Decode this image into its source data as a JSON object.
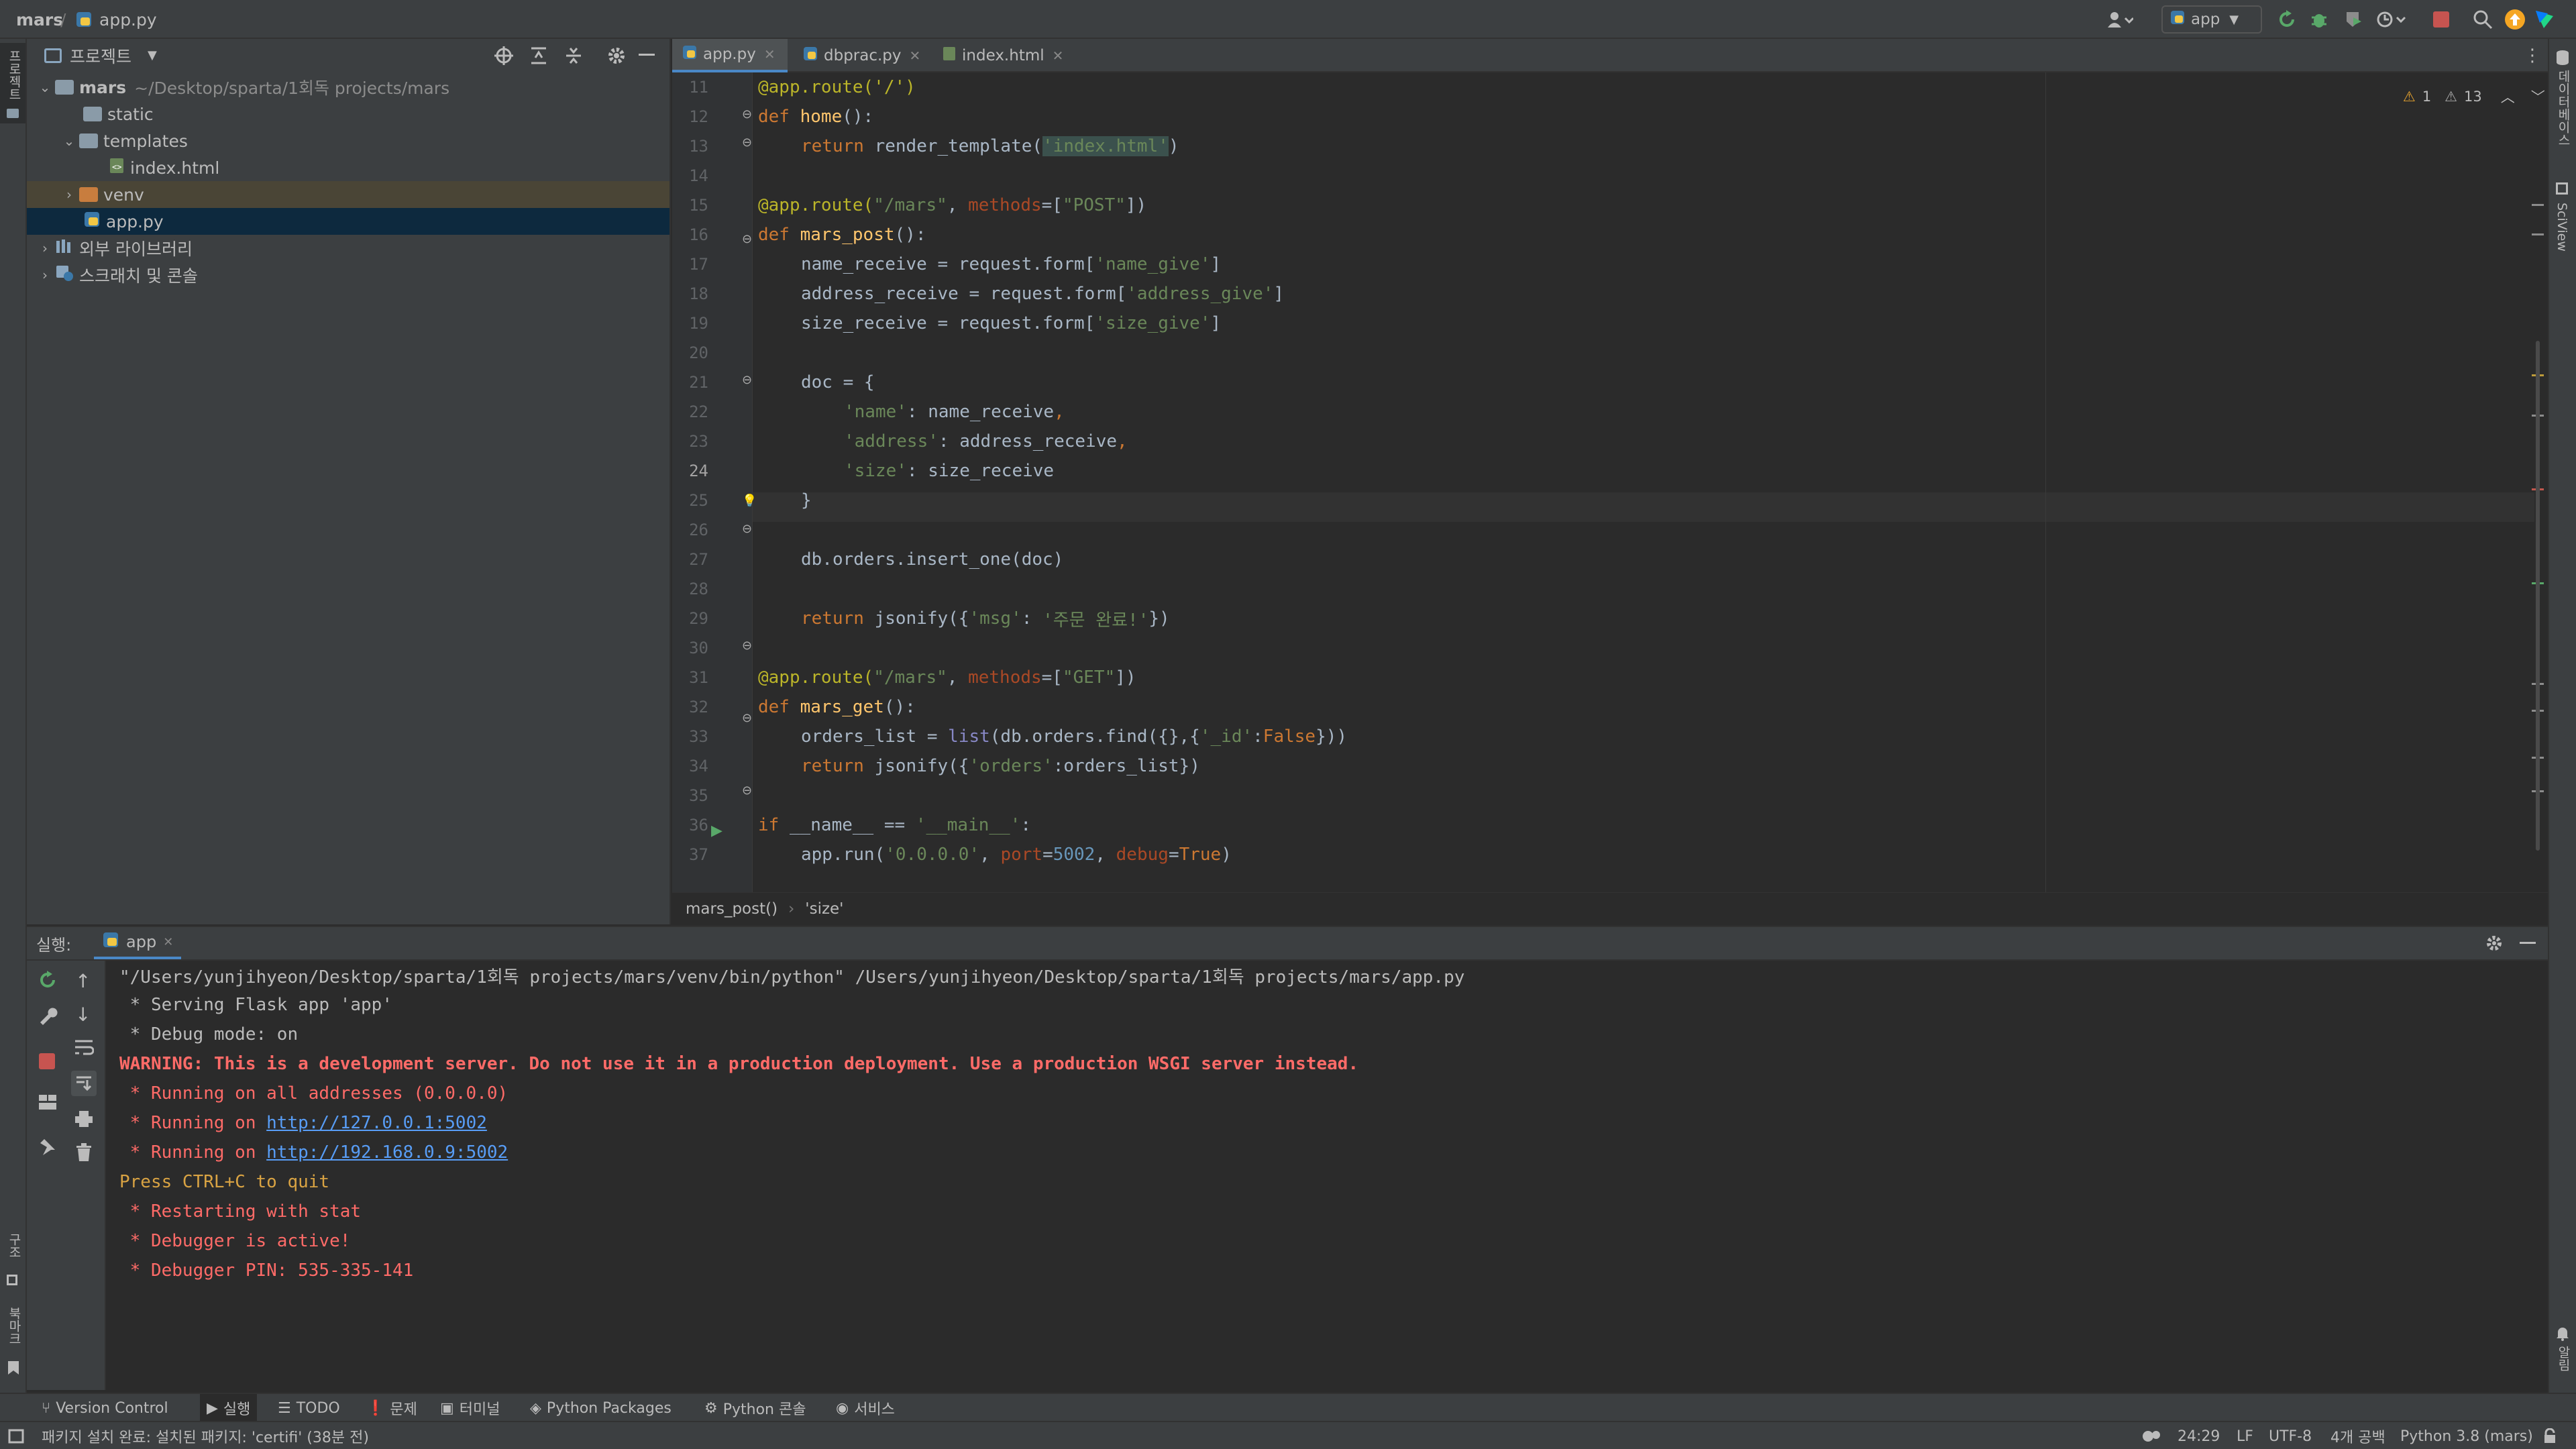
{
  "titlebar": {
    "project": "mars",
    "file": "app.py",
    "run_config": "app"
  },
  "left_strip": {
    "top_label": "프로젝트",
    "mid_label": "구조",
    "bottom_label": "북마크"
  },
  "right_strip": {
    "top_label": "데이터베이스",
    "mid_label": "SciView",
    "bottom_label": "알림"
  },
  "project_panel": {
    "title": "프로젝트",
    "tree": [
      {
        "label": "mars",
        "path": "~/Desktop/sparta/1회독 projects/mars",
        "expanded": true,
        "indent": 0
      },
      {
        "label": "static",
        "indent": 1
      },
      {
        "label": "templates",
        "expanded": true,
        "indent": 1
      },
      {
        "label": "index.html",
        "indent": 2
      },
      {
        "label": "venv",
        "indent": 1
      },
      {
        "label": "app.py",
        "indent": 1
      },
      {
        "label": "외부 라이브러리",
        "indent": 0
      },
      {
        "label": "스크래치 및 콘솔",
        "indent": 0
      }
    ]
  },
  "editor": {
    "tabs": [
      {
        "label": "app.py",
        "active": true
      },
      {
        "label": "dbprac.py",
        "active": false
      },
      {
        "label": "index.html",
        "active": false
      }
    ],
    "inspections": {
      "warnings": "1",
      "weak_warnings": "13"
    },
    "line_numbers": [
      "11",
      "12",
      "13",
      "14",
      "15",
      "16",
      "17",
      "18",
      "19",
      "20",
      "21",
      "22",
      "23",
      "24",
      "25",
      "26",
      "27",
      "28",
      "29",
      "30",
      "31",
      "32",
      "33",
      "34",
      "35",
      "36",
      "37"
    ],
    "breadcrumb": [
      "mars_post()",
      "'size'"
    ]
  },
  "run_panel": {
    "label": "실행:",
    "tab": "app",
    "output": [
      "\"/Users/yunjihyeon/Desktop/sparta/1회독 projects/mars/venv/bin/python\" /Users/yunjihyeon/Desktop/sparta/1회독 projects/mars/app.py",
      " * Serving Flask app 'app'",
      " * Debug mode: on",
      "WARNING: This is a development server. Do not use it in a production deployment. Use a production WSGI server instead.",
      " * Running on all addresses (0.0.0.0)",
      " * Running on ",
      "http://127.0.0.1:5002",
      " * Running on ",
      "http://192.168.0.9:5002",
      "Press CTRL+C to quit",
      " * Restarting with stat",
      " * Debugger is active!",
      " * Debugger PIN: 535-335-141"
    ]
  },
  "bottom_tabs": [
    {
      "label": "Version Control"
    },
    {
      "label": "실행"
    },
    {
      "label": "TODO"
    },
    {
      "label": "문제"
    },
    {
      "label": "터미널"
    },
    {
      "label": "Python Packages"
    },
    {
      "label": "Python 콘솔"
    },
    {
      "label": "서비스"
    }
  ],
  "status": {
    "message": "패키지 설치 완료: 설치된 패키지: 'certifi' (38분 전)",
    "position": "24:29",
    "line_sep": "LF",
    "encoding": "UTF-8",
    "indent": "4개 공백",
    "interpreter": "Python 3.8 (mars)"
  },
  "code": {
    "l11": "@app.route('/')",
    "l12_kw": "def ",
    "l12_fn": "home",
    "l12_rest": "():",
    "l13_kw": "return ",
    "l13_a": "render_template(",
    "l13_s": "'index.html'",
    "l13_b": ")",
    "l15_dec": "@app.route(",
    "l15_s": "\"/mars\"",
    "l15_c": ", ",
    "l15_p": "methods",
    "l15_e": "=[",
    "l15_s2": "\"POST\"",
    "l15_end": "])",
    "l16_kw": "def ",
    "l16_fn": "mars_post",
    "l16_rest": "():",
    "l17_a": "name_receive = request.form[",
    "l17_s": "'name_give'",
    "l17_b": "]",
    "l18_a": "address_receive = request.form[",
    "l18_s": "'address_give'",
    "l18_b": "]",
    "l19_a": "size_receive = request.form[",
    "l19_s": "'size_give'",
    "l19_b": "]",
    "l21": "doc = {",
    "l22_s": "'name'",
    "l22_a": ": name_receive",
    "l22_c": ",",
    "l23_s": "'address'",
    "l23_a": ": address_receive",
    "l23_c": ",",
    "l24_s": "'size'",
    "l24_a": ": size_receive",
    "l25": "}",
    "l27": "db.orders.insert_one(doc)",
    "l29_kw": "return ",
    "l29_a": "jsonify({",
    "l29_s": "'msg'",
    "l29_b": ": ",
    "l29_s2": "'주문 완료!'",
    "l29_c": "})",
    "l31_dec": "@app.route(",
    "l31_s": "\"/mars\"",
    "l31_c": ", ",
    "l31_p": "methods",
    "l31_e": "=[",
    "l31_s2": "\"GET\"",
    "l31_end": "])",
    "l32_kw": "def ",
    "l32_fn": "mars_get",
    "l32_rest": "():",
    "l33_a": "orders_list = ",
    "l33_bi": "list",
    "l33_b": "(db.orders.find({},{",
    "l33_s": "'_id'",
    "l33_c": ":",
    "l33_kw": "False",
    "l33_d": "}))",
    "l34_kw": "return ",
    "l34_a": "jsonify({",
    "l34_s": "'orders'",
    "l34_b": ":orders_list})",
    "l36_kw": "if ",
    "l36_a": "__name__ == ",
    "l36_s": "'__main__'",
    "l36_b": ":",
    "l37_a": "app.run(",
    "l37_s": "'0.0.0.0'",
    "l37_c": ", ",
    "l37_p": "port",
    "l37_e": "=",
    "l37_n": "5002",
    "l37_c2": ", ",
    "l37_p2": "debug",
    "l37_e2": "=",
    "l37_kw": "True",
    "l37_end": ")"
  }
}
